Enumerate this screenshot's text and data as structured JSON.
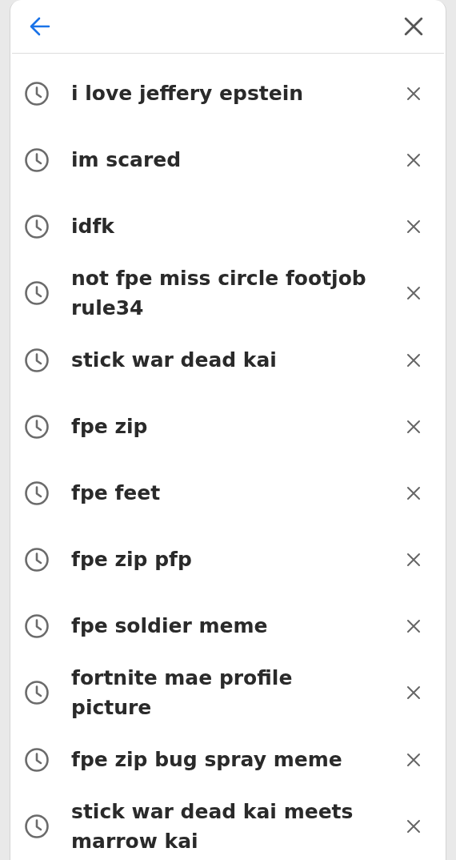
{
  "history": [
    {
      "query": "i love jeffery epstein"
    },
    {
      "query": "im scared"
    },
    {
      "query": "idfk"
    },
    {
      "query": "not fpe miss circle footjob rule34"
    },
    {
      "query": "stick war dead kai"
    },
    {
      "query": "fpe zip"
    },
    {
      "query": "fpe feet"
    },
    {
      "query": "fpe zip pfp"
    },
    {
      "query": "fpe soldier meme"
    },
    {
      "query": "fortnite mae profile picture"
    },
    {
      "query": "fpe zip bug spray meme"
    },
    {
      "query": "stick war dead kai meets marrow kai"
    }
  ]
}
